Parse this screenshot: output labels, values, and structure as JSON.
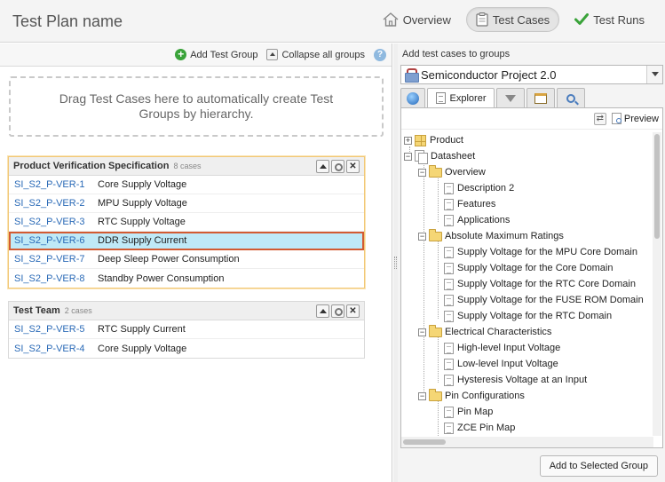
{
  "header": {
    "title": "Test Plan name",
    "nav": [
      {
        "label": "Overview",
        "icon": "home-icon"
      },
      {
        "label": "Test Cases",
        "icon": "clipboard-icon",
        "active": true
      },
      {
        "label": "Test Runs",
        "icon": "checkmark-icon"
      }
    ]
  },
  "left": {
    "toolbar": {
      "add_group": "Add Test Group",
      "collapse_all": "Collapse all groups"
    },
    "dropzone_text": "Drag Test Cases here to automatically create Test Groups by hierarchy.",
    "groups": [
      {
        "name": "Product Verification Specification",
        "count": "8 cases",
        "rows": [
          {
            "id": "SI_S2_P-VER-1",
            "name": "Core Supply Voltage"
          },
          {
            "id": "SI_S2_P-VER-2",
            "name": "MPU Supply Voltage"
          },
          {
            "id": "SI_S2_P-VER-3",
            "name": "RTC Supply Voltage"
          },
          {
            "id": "SI_S2_P-VER-6",
            "name": "DDR Supply Current",
            "selected": true
          },
          {
            "id": "SI_S2_P-VER-7",
            "name": "Deep Sleep Power Consumption"
          },
          {
            "id": "SI_S2_P-VER-8",
            "name": "Standby Power Consumption"
          }
        ]
      },
      {
        "name": "Test Team",
        "count": "2 cases",
        "rows": [
          {
            "id": "SI_S2_P-VER-5",
            "name": "RTC Supply Current"
          },
          {
            "id": "SI_S2_P-VER-4",
            "name": "Core Supply Voltage"
          }
        ]
      }
    ]
  },
  "right": {
    "label": "Add test cases to groups",
    "project": "Semiconductor Project 2.0",
    "tabs": {
      "explorer": "Explorer"
    },
    "preview": "Preview",
    "tree": [
      "Product",
      "Datasheet",
      "Overview",
      "Description 2",
      "Features",
      "Applications",
      "Absolute Maximum Ratings",
      "Supply Voltage for the MPU Core Domain",
      "Supply Voltage for the Core Domain",
      "Supply Voltage for the RTC Core Domain",
      "Supply Voltage for the FUSE ROM Domain",
      "Supply Voltage for the RTC Domain",
      "Electrical Characteristics",
      "High-level Input Voltage",
      "Low-level Input Voltage",
      "Hysteresis Voltage at an Input",
      "Pin Configurations",
      "Pin Map",
      "ZCE Pin Map"
    ],
    "add_button": "Add to Selected Group"
  }
}
